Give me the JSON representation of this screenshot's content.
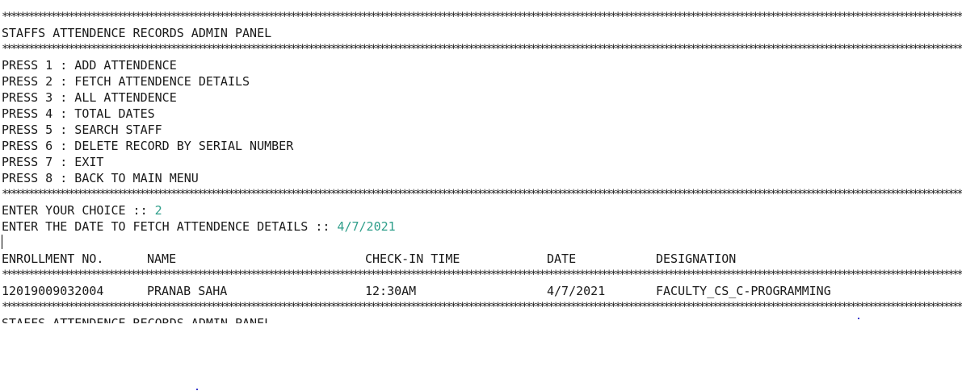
{
  "separator": "**************************************************************************************************************************************************************************************************************************************",
  "panel_title": "STAFFS ATTENDENCE RECORDS ADMIN PANEL",
  "menu": [
    "PRESS 1 : ADD ATTENDENCE",
    "PRESS 2 : FETCH ATTENDENCE DETAILS",
    "PRESS 3 : ALL ATTENDENCE",
    "PRESS 4 : TOTAL DATES",
    "PRESS 5 : SEARCH STAFF",
    "PRESS 6 : DELETE RECORD BY SERIAL NUMBER",
    "PRESS 7 : EXIT",
    "PRESS 8 : BACK TO MAIN MENU"
  ],
  "choice_prompt": "ENTER YOUR CHOICE :: ",
  "choice_value": "2",
  "date_prompt": "ENTER THE DATE TO FETCH ATTENDENCE DETAILS :: ",
  "date_value": "4/7/2021",
  "table": {
    "headers": [
      "ENROLLMENT NO.",
      "NAME",
      "CHECK-IN TIME",
      "DATE",
      "DESIGNATION"
    ],
    "rows": [
      [
        "12019009032004",
        "PRANAB SAHA",
        "12:30AM",
        "4/7/2021",
        "FACULTY_CS_C-PROGRAMMING"
      ]
    ]
  },
  "trailing_title": "STAFFS ATTENDENCE RECORDS ADMIN PANEL"
}
